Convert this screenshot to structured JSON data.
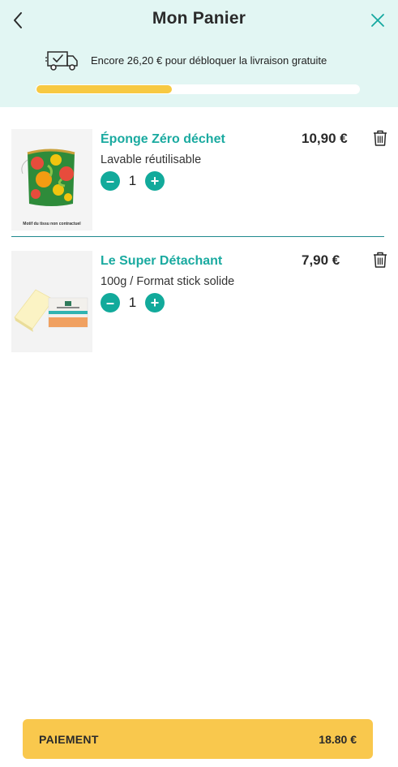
{
  "header": {
    "title": "Mon Panier",
    "back_icon": "chevron-left-icon",
    "close_icon": "close-icon"
  },
  "shipping": {
    "message": "Encore 26,20 € pour débloquer la livraison gratuite",
    "icon": "delivery-truck-icon",
    "progress_fraction": 0.42,
    "progress_color": "#f7c942"
  },
  "items": [
    {
      "name": "Éponge Zéro déchet",
      "variant": "Lavable réutilisable",
      "quantity": "1",
      "price": "10,90 €",
      "image_caption": "Motif du tissu non contractuel",
      "minus_label": "–",
      "plus_label": "+"
    },
    {
      "name": "Le Super Détachant",
      "variant": "100g / Format stick solide",
      "quantity": "1",
      "price": "7,90 €",
      "minus_label": "–",
      "plus_label": "+"
    }
  ],
  "checkout": {
    "label": "PAIEMENT",
    "total": "18.80 €"
  },
  "colors": {
    "accent": "#12aa9b",
    "header_bg": "#e2f6f3",
    "pay_button": "#f9c84d"
  }
}
